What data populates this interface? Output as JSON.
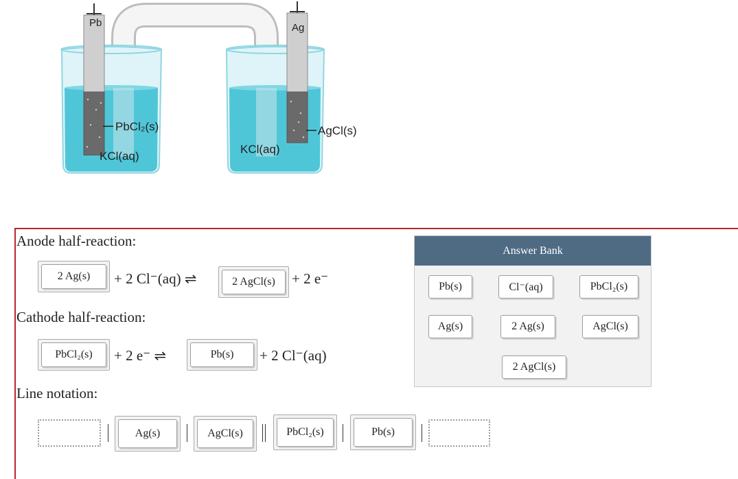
{
  "figure": {
    "electrode_left": "Pb",
    "electrode_right": "Ag",
    "left_solid_label": "PbCl₂(s)",
    "right_solid_label": "AgCl(s)",
    "left_solution_label": "KCl(aq)",
    "right_solution_label": "KCl(aq)"
  },
  "anode": {
    "label": "Anode half-reaction:",
    "slot1": "2 Ag(s)",
    "text1": "+ 2 Cl⁻(aq) ⇌",
    "slot2": "2 AgCl(s)",
    "text2": "+ 2 e⁻"
  },
  "cathode": {
    "label": "Cathode half-reaction:",
    "slot1": "PbCl₂(s)",
    "text1": "+ 2 e⁻ ⇌",
    "slot2": "Pb(s)",
    "text2": "+ 2 Cl⁻(aq)"
  },
  "line_notation": {
    "label": "Line notation:",
    "slots": [
      "",
      "Ag(s)",
      "AgCl(s)",
      "PbCl₂(s)",
      "Pb(s)",
      ""
    ]
  },
  "answer_bank": {
    "title": "Answer Bank",
    "tiles": [
      "Pb(s)",
      "Cl⁻(aq)",
      "PbCl₂(s)",
      "Ag(s)",
      "2 Ag(s)",
      "AgCl(s)",
      "2 AgCl(s)"
    ]
  },
  "colors": {
    "solution": "#4fc6d8",
    "glass": "#cfeef4",
    "panel_border": "#b5262b",
    "bank_header": "#4f6b84"
  }
}
